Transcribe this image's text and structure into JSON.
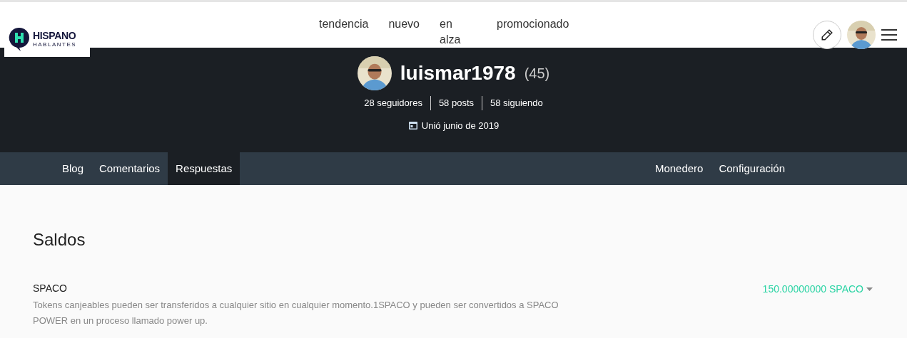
{
  "logo": {
    "title": "HISPANO",
    "subtitle": "HABLANTES"
  },
  "nav": [
    "tendencia",
    "nuevo",
    "en alza",
    "promocionado"
  ],
  "profile": {
    "username": "luismar1978",
    "reputation": "(45)",
    "stats": [
      "28 seguidores",
      "58 posts",
      "58 siguiendo"
    ],
    "joined": "Unió junio de 2019"
  },
  "tabs": [
    {
      "label": "Blog",
      "selected": false
    },
    {
      "label": "Comentarios",
      "selected": false
    },
    {
      "label": "Respuestas",
      "selected": true
    }
  ],
  "right_tabs": [
    "Monedero",
    "Configuración"
  ],
  "section_title": "Saldos",
  "balances": [
    {
      "name": "SPACO",
      "description": "Tokens canjeables pueden ser transferidos a cualquier sitio en cualquier momento.1SPACO y pueden ser convertidos a SPACO POWER en un proceso llamado power up.",
      "amount": "150.00000000 SPACO"
    }
  ]
}
